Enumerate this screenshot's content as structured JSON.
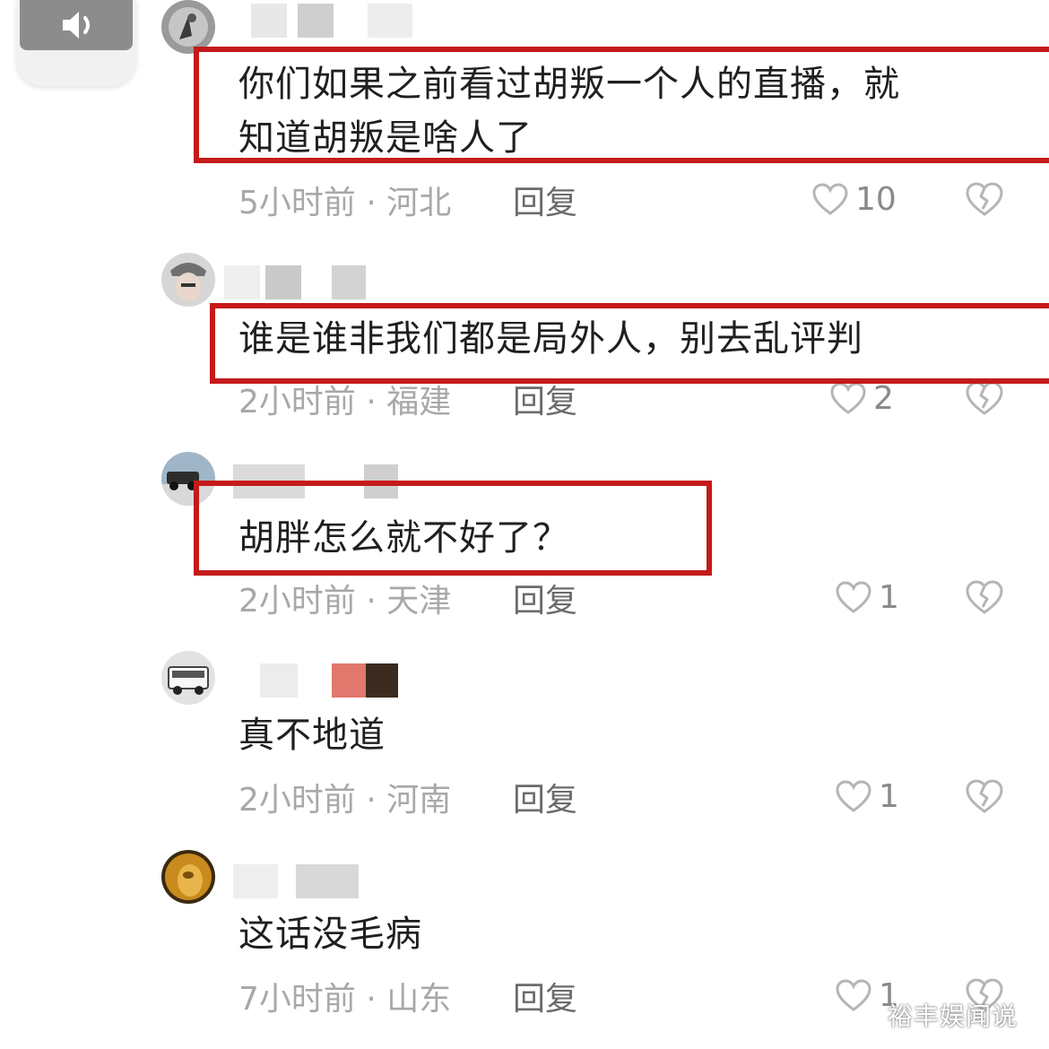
{
  "comments": [
    {
      "text_lines": [
        "你们如果之前看过胡叛一个人的直播，就",
        "知道胡叛是啥人了"
      ],
      "time": "5小时前",
      "location": "河北",
      "reply_label": "回复",
      "likes": "10"
    },
    {
      "text_lines": [
        "谁是谁非我们都是局外人，别去乱评判"
      ],
      "time": "2小时前",
      "location": "福建",
      "reply_label": "回复",
      "likes": "2"
    },
    {
      "text_lines": [
        "胡胖怎么就不好了？"
      ],
      "time": "2小时前",
      "location": "天津",
      "reply_label": "回复",
      "likes": "1"
    },
    {
      "text_lines": [
        "真不地道"
      ],
      "time": "2小时前",
      "location": "河南",
      "reply_label": "回复",
      "likes": "1"
    },
    {
      "text_lines": [
        "这话没毛病"
      ],
      "time": "7小时前",
      "location": "山东",
      "reply_label": "回复",
      "likes": "1"
    }
  ],
  "meta_separator": "·",
  "watermark": "裕丰娱闻说",
  "colors": {
    "highlight_box": "#c41a1a",
    "text": "#1f1f1f",
    "meta": "#a8a8a8"
  },
  "icons": {
    "volume": "speaker-icon",
    "like": "heart-outline-icon",
    "dislike": "broken-heart-icon"
  }
}
